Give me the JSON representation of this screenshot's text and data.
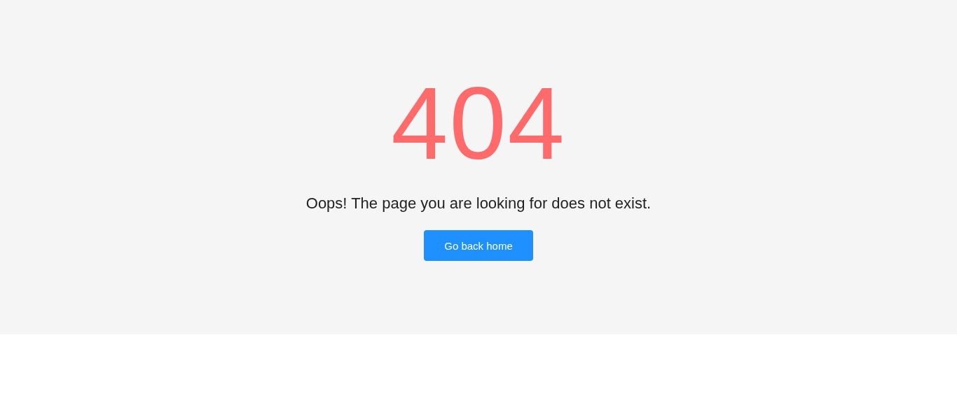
{
  "error_code": "404",
  "message": "Oops! The page you are looking for does not exist.",
  "button": {
    "label": "Go back home"
  }
}
